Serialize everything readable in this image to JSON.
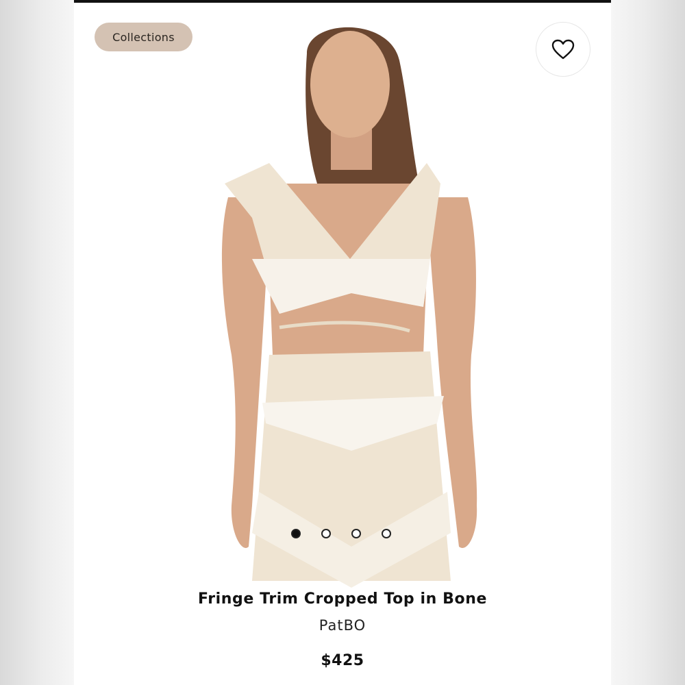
{
  "header": {
    "collections_label": "Collections",
    "favorite_icon": "heart-outline-icon"
  },
  "gallery": {
    "image_subject": "product-photo",
    "image_count": 4,
    "active_index": 0
  },
  "product": {
    "title": "Fringe Trim Cropped Top in Bone",
    "brand": "PatBO",
    "price": "$425"
  },
  "colors": {
    "chip_background": "#d4c2b3",
    "text_primary": "#111111",
    "garment": "#efe4d2",
    "skin": "#d9a98a",
    "hair": "#6a4630"
  }
}
